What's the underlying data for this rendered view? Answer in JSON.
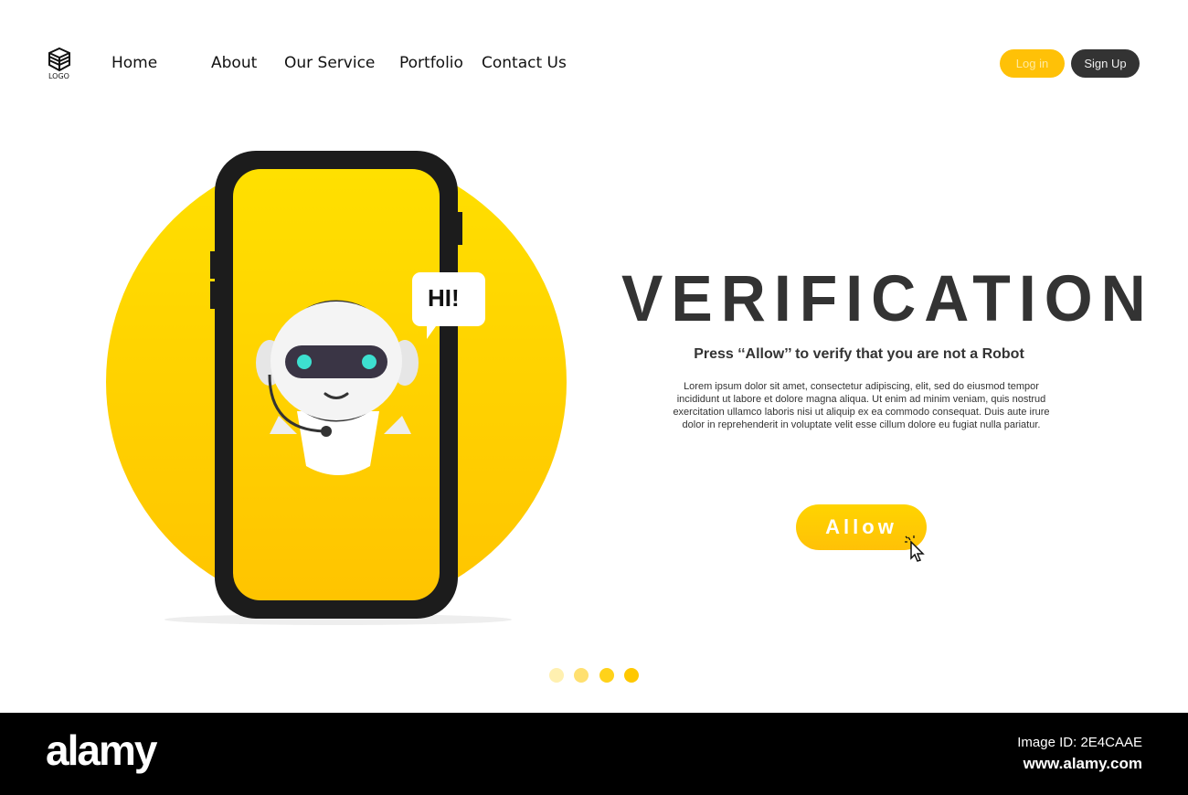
{
  "header": {
    "logo_text": "LOGO",
    "nav": [
      "Home",
      "About",
      "Our Service",
      "Portfolio",
      "Contact Us"
    ],
    "login": "Log in",
    "signup": "Sign Up"
  },
  "hero": {
    "bubble": "HI!",
    "title": "VERIFICATION",
    "subtitle": "Press ‘‘Allow’’ to verify that you are not a Robot",
    "body": "Lorem ipsum dolor sit amet, consectetur adipiscing, elit, sed do eiusmod tempor incididunt ut labore et dolore magna aliqua. Ut enim ad minim veniam, quis nostrud exercitation ullamco laboris nisi ut aliquip ex ea commodo consequat. Duis aute irure dolor in reprehenderit in voluptate velit esse cillum dolore eu fugiat nulla pariatur.",
    "allow_button": "Allow"
  },
  "pagination": {
    "count": 4,
    "active": 4
  },
  "footer": {
    "brand": "alamy",
    "image_id": "Image ID: 2E4CAAE",
    "url": "www.alamy.com"
  },
  "colors": {
    "accent": "#ffcc00",
    "dark": "#333333",
    "robot_eye": "#3de0d0"
  }
}
